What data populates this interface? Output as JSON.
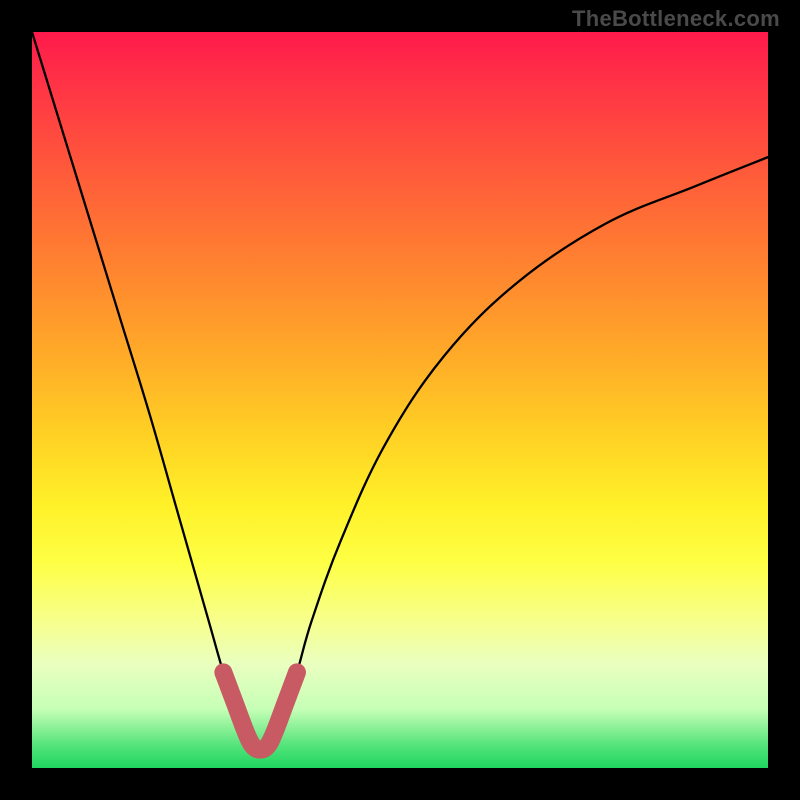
{
  "watermark": "TheBottleneck.com",
  "chart_data": {
    "type": "line",
    "title": "",
    "xlabel": "",
    "ylabel": "",
    "xlim": [
      0,
      100
    ],
    "ylim": [
      0,
      100
    ],
    "series": [
      {
        "name": "main-curve",
        "x": [
          0,
          4,
          8,
          12,
          16,
          20,
          24,
          26,
          28,
          29,
          30,
          31,
          32,
          33,
          34,
          36,
          38,
          42,
          48,
          56,
          66,
          78,
          90,
          100
        ],
        "values": [
          100,
          87,
          74,
          61,
          48,
          34,
          20,
          13,
          7,
          4,
          2,
          1.5,
          2,
          4,
          7,
          13,
          20,
          31,
          44,
          56,
          66,
          74,
          79,
          83
        ]
      },
      {
        "name": "trough-highlight",
        "x": [
          26,
          27.5,
          29,
          30,
          31,
          32,
          33,
          34.5,
          36
        ],
        "values": [
          13,
          9,
          5,
          3,
          2.5,
          3,
          5,
          9,
          13
        ]
      }
    ],
    "colors": {
      "curve": "#000000",
      "highlight": "#c85a63"
    }
  }
}
